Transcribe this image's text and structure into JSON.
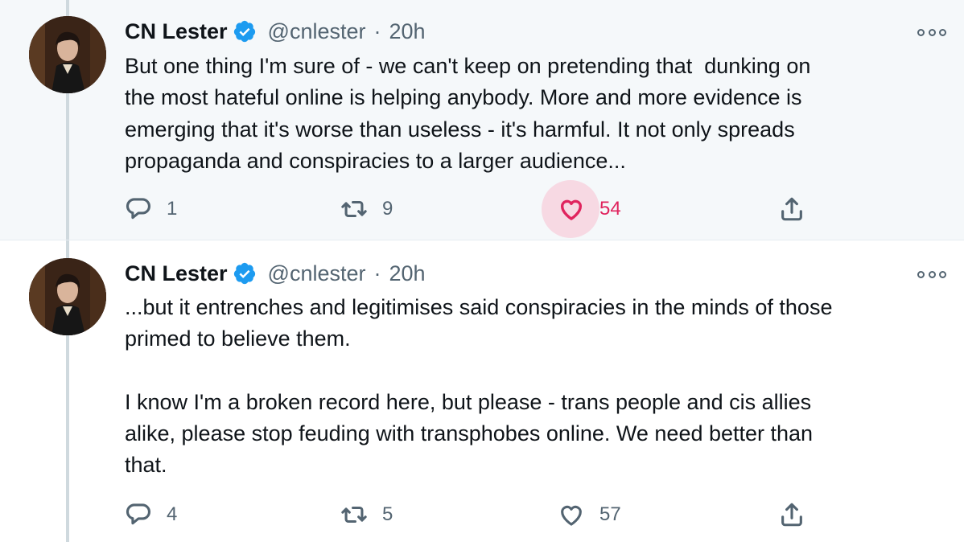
{
  "tweets": [
    {
      "author_name": "CN Lester",
      "handle": "@cnlester",
      "separator": "·",
      "time": "20h",
      "text": "But one thing I'm sure of - we can't keep on pretending that  dunking on\nthe most hateful online is helping anybody. More and more evidence is\nemerging that it's worse than useless - it's harmful. It not only spreads\npropaganda and conspiracies to a larger audience...",
      "reply_count": "1",
      "retweet_count": "9",
      "like_count": "54",
      "liked": true
    },
    {
      "author_name": "CN Lester",
      "handle": "@cnlester",
      "separator": "·",
      "time": "20h",
      "text": "...but it entrenches and legitimises said conspiracies in the minds of those\nprimed to believe them.\n\nI know I'm a broken record here, but please - trans people and cis allies\nalike, please stop feuding with transphobes online. We need better than\nthat.",
      "reply_count": "4",
      "retweet_count": "5",
      "like_count": "57",
      "liked": false
    }
  ],
  "icons": {
    "verified": "verified-badge-icon",
    "more": "more-options-icon",
    "reply": "reply-icon",
    "retweet": "retweet-icon",
    "like": "heart-icon",
    "share": "share-icon"
  },
  "colors": {
    "verified": "#1d9bf0",
    "like_active": "#e0245e",
    "secondary_text": "#536471",
    "highlight_bg": "#f5f8fa"
  }
}
